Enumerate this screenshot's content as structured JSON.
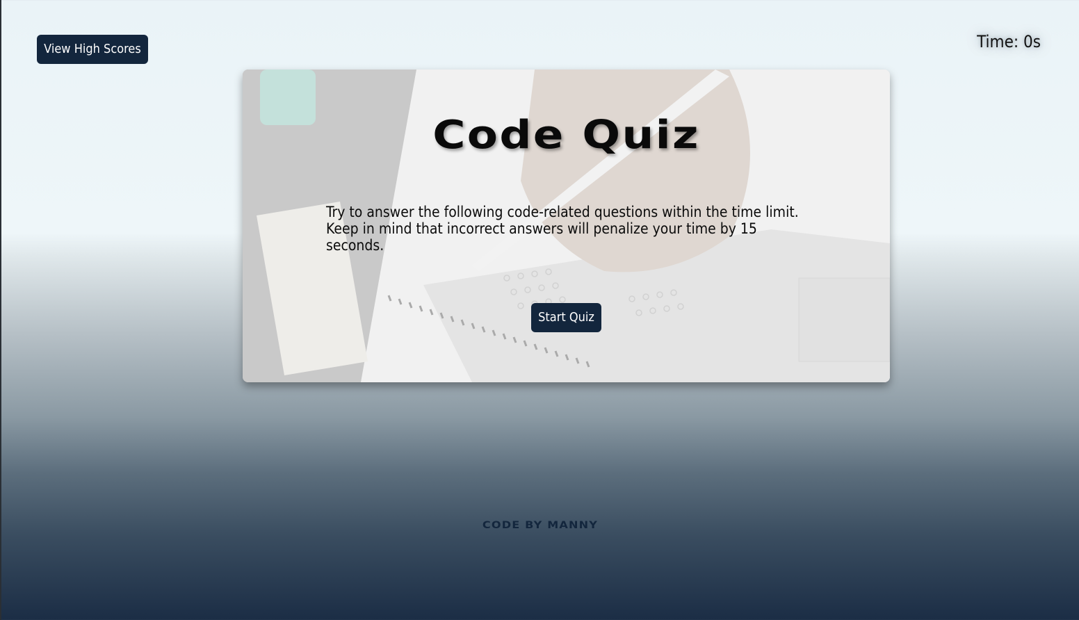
{
  "header": {
    "high_scores_label": "View High Scores",
    "timer_text": "Time: 0s"
  },
  "quiz": {
    "title": "Code Quiz",
    "description": "Try to answer the following code-related questions within the time limit. Keep in mind that incorrect answers will penalize your time by 15 seconds.",
    "start_label": "Start Quiz"
  },
  "footer": {
    "credit": "CODE BY MANNY"
  },
  "colors": {
    "button_bg": "#13263d",
    "button_text": "#ffffff",
    "page_top": "#eaf3f7",
    "page_bottom": "#1b2d45"
  }
}
